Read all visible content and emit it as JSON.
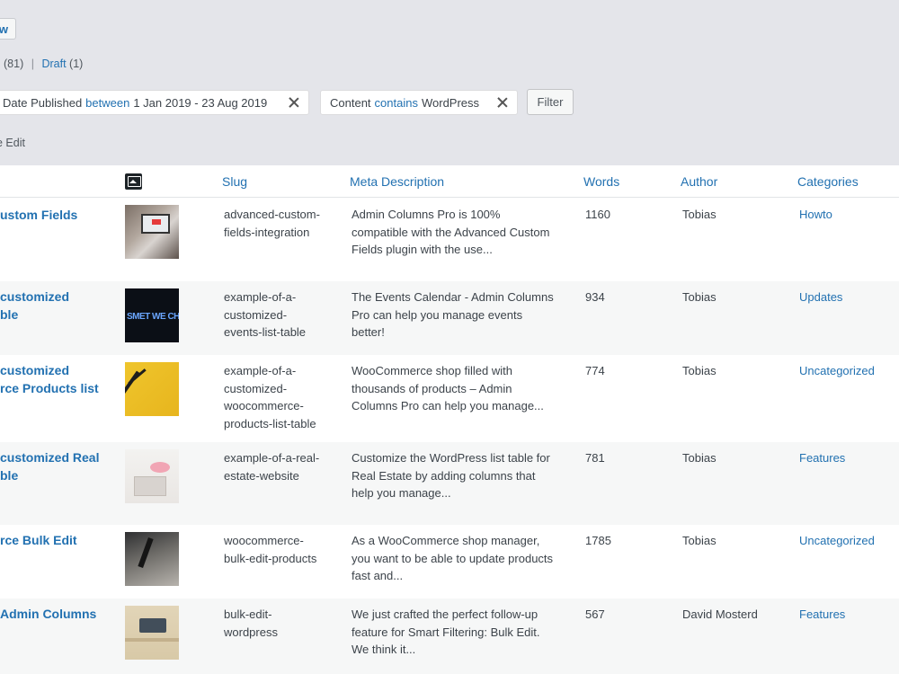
{
  "toolbar": {
    "add_new_label": "w"
  },
  "views": {
    "all_count": "(81)",
    "separator": "|",
    "draft_label": "Draft",
    "draft_count": "(1)"
  },
  "filters": [
    {
      "field": "Date Published",
      "operator": "between",
      "value": "1 Jan 2019 - 23 Aug 2019"
    },
    {
      "field": "Content",
      "operator": "contains",
      "value": "WordPress"
    }
  ],
  "filter_button_label": "Filter",
  "bulk_edit_label": "e Edit",
  "columns": {
    "slug": "Slug",
    "meta": "Meta Description",
    "words": "Words",
    "author": "Author",
    "categories": "Categories"
  },
  "rows": [
    {
      "title": [
        "ustom Fields"
      ],
      "slug": [
        "advanced-custom-",
        "fields-integration"
      ],
      "meta": [
        "Admin Columns Pro is 100%",
        "compatible with the Advanced Custom",
        "Fields plugin with the use..."
      ],
      "words": "1160",
      "author": "Tobias",
      "category": "Howto"
    },
    {
      "title": [
        " customized",
        "ble"
      ],
      "slug": [
        "example-of-a-",
        "customized-",
        "events-list-table"
      ],
      "meta": [
        "The Events Calendar - Admin Columns",
        "Pro can help you manage events",
        "better!"
      ],
      "words": "934",
      "author": "Tobias",
      "category": "Updates"
    },
    {
      "title": [
        " customized",
        "rce Products list"
      ],
      "slug": [
        "example-of-a-",
        "customized-",
        "woocommerce-",
        "products-list-table"
      ],
      "meta": [
        "WooCommerce shop filled with",
        "thousands of products – Admin",
        "Columns Pro can help you manage..."
      ],
      "words": "774",
      "author": "Tobias",
      "category": "Uncategorized"
    },
    {
      "title": [
        " customized Real",
        "ble"
      ],
      "slug": [
        "example-of-a-real-",
        "estate-website"
      ],
      "meta": [
        "Customize the WordPress list table for",
        "Real Estate by adding columns that",
        "help you manage..."
      ],
      "words": "781",
      "author": "Tobias",
      "category": "Features"
    },
    {
      "title": [
        "rce Bulk Edit"
      ],
      "slug": [
        "woocommerce-",
        "bulk-edit-products"
      ],
      "meta": [
        "As a WooCommerce shop manager,",
        "you want to be able to update products",
        "fast and..."
      ],
      "words": "1785",
      "author": "Tobias",
      "category": "Uncategorized"
    },
    {
      "title": [
        " Admin Columns"
      ],
      "slug": [
        "bulk-edit-",
        "wordpress"
      ],
      "meta": [
        "We just crafted the perfect follow-up",
        "feature for Smart Filtering: Bulk Edit.",
        "We think it..."
      ],
      "words": "567",
      "author": "David Mosterd",
      "category": "Features"
    }
  ]
}
